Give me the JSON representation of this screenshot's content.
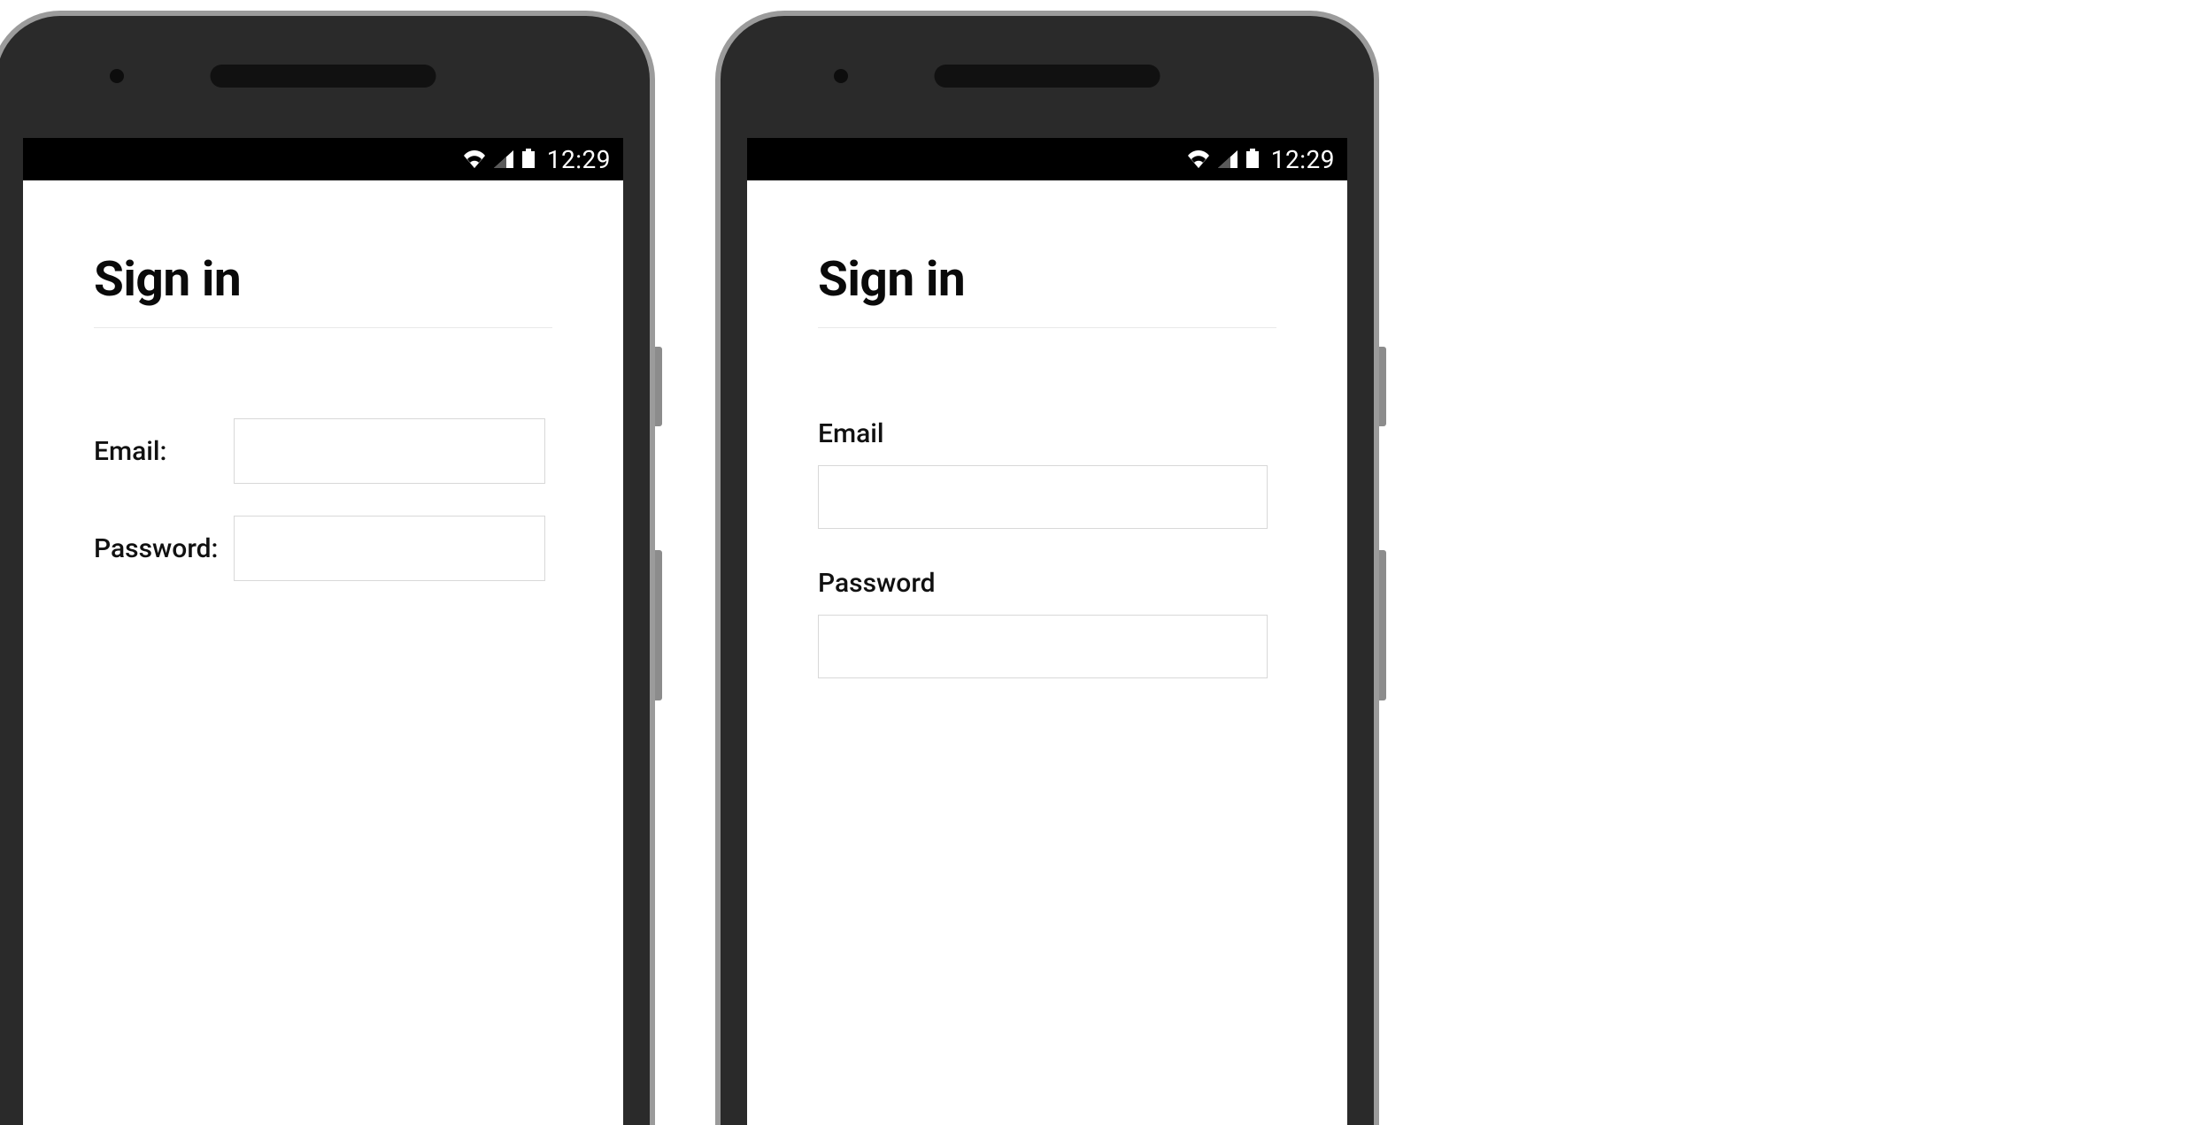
{
  "status": {
    "time": "12:29"
  },
  "left": {
    "title": "Sign in",
    "email_label": "Email:",
    "password_label": "Password:",
    "email_value": "",
    "password_value": ""
  },
  "right": {
    "title": "Sign in",
    "email_label": "Email",
    "password_label": "Password",
    "email_value": "",
    "password_value": ""
  }
}
